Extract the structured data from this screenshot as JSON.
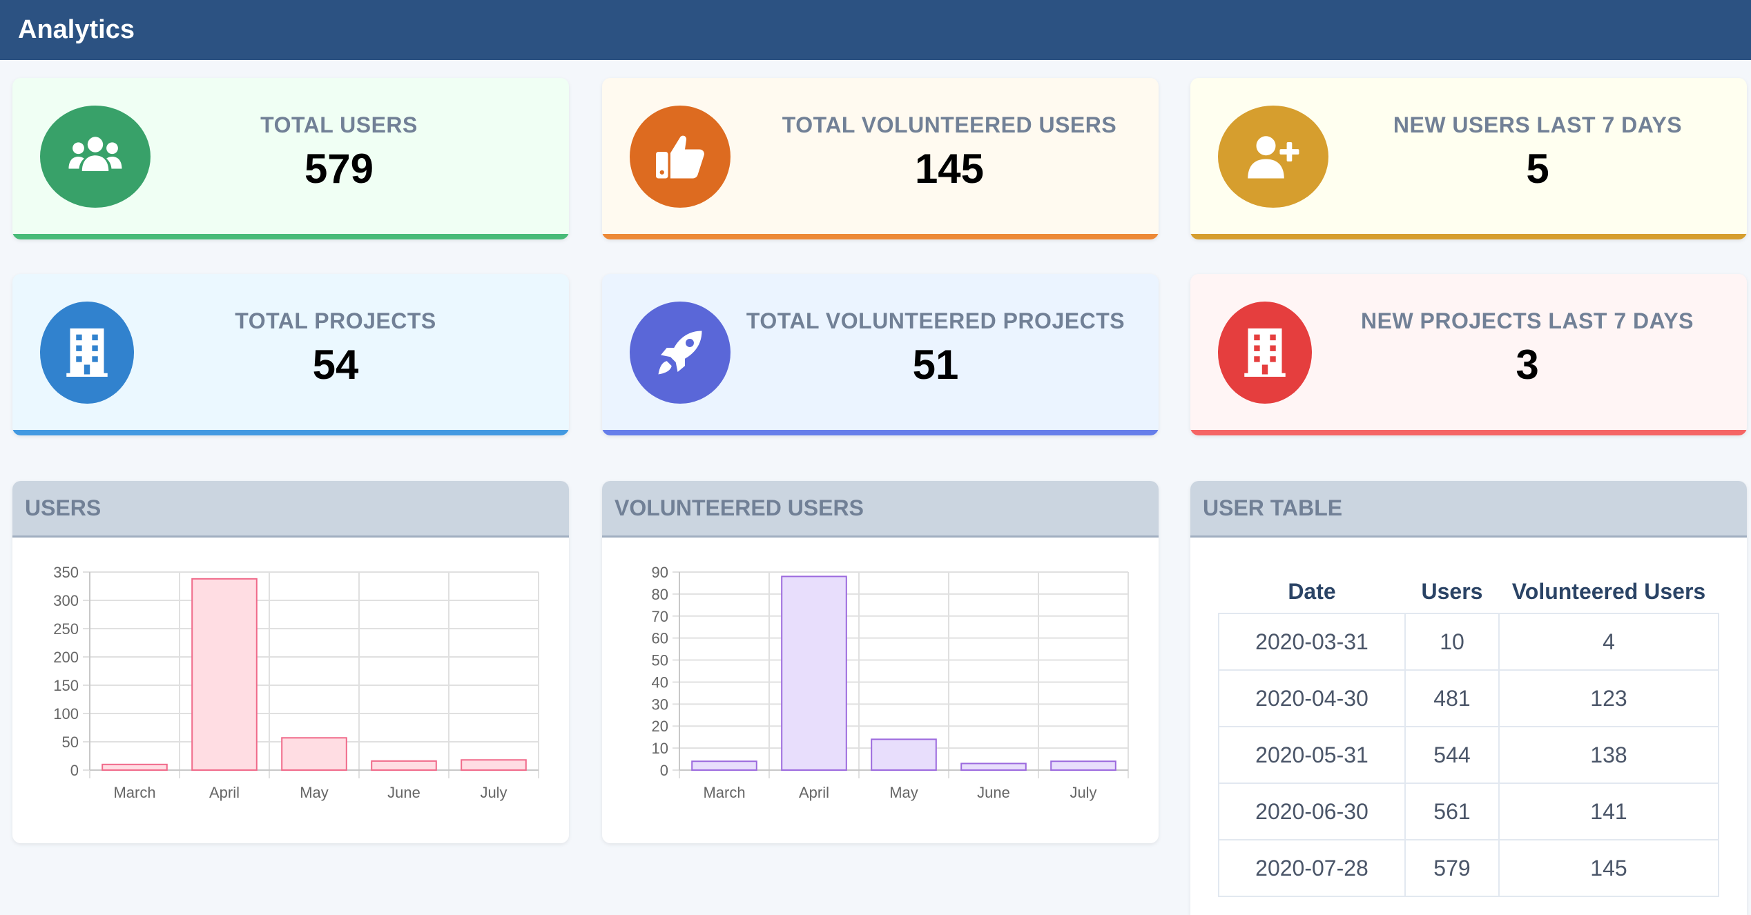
{
  "header": {
    "title": "Analytics"
  },
  "colors": {
    "topbar": "#2c5282",
    "green": "#38a169",
    "orange": "#dd6b20",
    "gold": "#d69e2e",
    "blue": "#3182ce",
    "indigo": "#5a67d8",
    "red": "#e53e3e"
  },
  "stats": [
    {
      "label": "TOTAL USERS",
      "value": "579",
      "icon": "users-icon"
    },
    {
      "label": "TOTAL VOLUNTEERED USERS",
      "value": "145",
      "icon": "thumbs-up-icon"
    },
    {
      "label": "NEW USERS LAST 7 DAYS",
      "value": "5",
      "icon": "user-plus-icon"
    },
    {
      "label": "TOTAL PROJECTS",
      "value": "54",
      "icon": "building-icon"
    },
    {
      "label": "TOTAL VOLUNTEERED PROJECTS",
      "value": "51",
      "icon": "rocket-icon"
    },
    {
      "label": "NEW PROJECTS LAST 7 DAYS",
      "value": "3",
      "icon": "building-icon"
    }
  ],
  "panels": {
    "users_title": "USERS",
    "volunteered_title": "VOLUNTEERED USERS",
    "table_title": "USER TABLE"
  },
  "chart_data": [
    {
      "type": "bar",
      "categories": [
        "March",
        "April",
        "May",
        "June",
        "July"
      ],
      "values": [
        10,
        338,
        57,
        16,
        18
      ],
      "ylim": [
        0,
        350
      ],
      "yticks": [
        0,
        50,
        100,
        150,
        200,
        250,
        300,
        350
      ],
      "grid": true,
      "fill": "#ffdde3",
      "stroke": "#f06a8a"
    },
    {
      "type": "bar",
      "categories": [
        "March",
        "April",
        "May",
        "June",
        "July"
      ],
      "values": [
        4,
        88,
        14,
        3,
        4
      ],
      "ylim": [
        0,
        90
      ],
      "yticks": [
        0,
        10,
        20,
        30,
        40,
        50,
        60,
        70,
        80,
        90
      ],
      "grid": true,
      "fill": "#e8defc",
      "stroke": "#9c6ade"
    }
  ],
  "table": {
    "headers": [
      "Date",
      "Users",
      "Volunteered Users"
    ],
    "rows": [
      [
        "2020-03-31",
        "10",
        "4"
      ],
      [
        "2020-04-30",
        "481",
        "123"
      ],
      [
        "2020-05-31",
        "544",
        "138"
      ],
      [
        "2020-06-30",
        "561",
        "141"
      ],
      [
        "2020-07-28",
        "579",
        "145"
      ]
    ]
  }
}
